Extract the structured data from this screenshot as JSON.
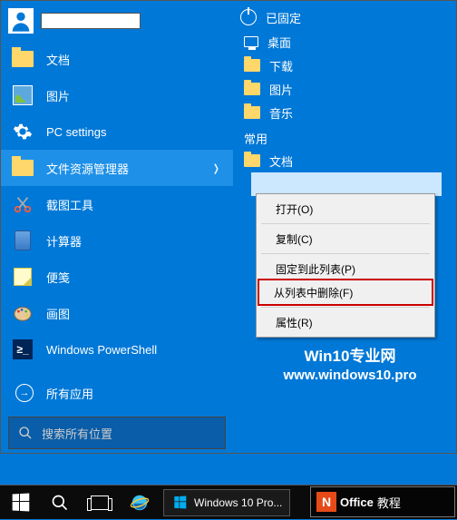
{
  "user": {
    "name": ""
  },
  "left_apps": [
    {
      "label": "文档",
      "icon": "documents"
    },
    {
      "label": "图片",
      "icon": "pictures"
    },
    {
      "label": "PC settings",
      "icon": "settings"
    },
    {
      "label": "文件资源管理器",
      "icon": "file-explorer",
      "selected": true,
      "has_jump": true
    },
    {
      "label": "截图工具",
      "icon": "snipping"
    },
    {
      "label": "计算器",
      "icon": "calculator"
    },
    {
      "label": "便笺",
      "icon": "sticky-notes"
    },
    {
      "label": "画图",
      "icon": "paint"
    },
    {
      "label": "Windows PowerShell",
      "icon": "powershell"
    }
  ],
  "all_apps_label": "所有应用",
  "search": {
    "placeholder": "搜索所有位置"
  },
  "right": {
    "pinned_header": "已固定",
    "pinned": [
      {
        "label": "桌面",
        "icon": "desktop"
      },
      {
        "label": "下载",
        "icon": "folder"
      },
      {
        "label": "图片",
        "icon": "folder"
      },
      {
        "label": "音乐",
        "icon": "folder"
      }
    ],
    "frequent_header": "常用",
    "frequent": [
      {
        "label": "文档",
        "icon": "folder"
      }
    ]
  },
  "context_menu": {
    "open": "打开(O)",
    "copy": "复制(C)",
    "pin": "固定到此列表(P)",
    "remove": "从列表中删除(F)",
    "properties": "属性(R)"
  },
  "watermark": {
    "line1": "Win10专业网",
    "line2": "www.windows10.pro"
  },
  "taskbar": {
    "task_label": "Windows 10 Pro..."
  },
  "office_badge": {
    "text1": "Office",
    "text2": "教程"
  }
}
